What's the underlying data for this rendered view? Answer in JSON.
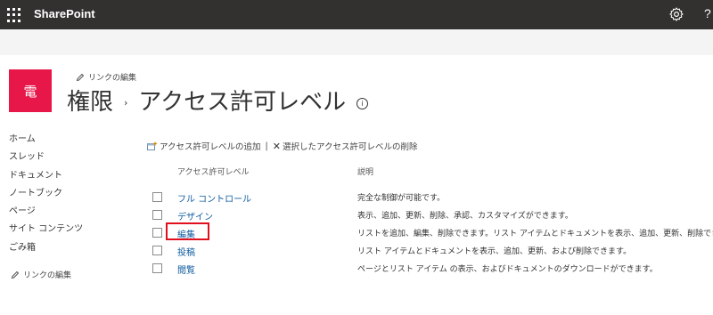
{
  "suite_bar": {
    "app_name": "SharePoint",
    "help_label": "?",
    "icons": [
      "waffle-icon",
      "gear-icon",
      "help-icon"
    ]
  },
  "site": {
    "logo_text": "電",
    "logo_color": "#e8174a",
    "edit_links_label": "リンクの編集"
  },
  "page": {
    "breadcrumb_parent": "権限",
    "breadcrumb_separator": "›",
    "title": "アクセス許可レベル",
    "info_icon": "i"
  },
  "quick_launch": {
    "items": [
      "ホーム",
      "スレッド",
      "ドキュメント",
      "ノートブック",
      "ページ",
      "サイト コンテンツ",
      "ごみ箱"
    ],
    "edit_links_label": "リンクの編集"
  },
  "toolbar": {
    "add_label": "アクセス許可レベルの追加",
    "separator": "|",
    "delete_label": "選択したアクセス許可レベルの削除"
  },
  "table": {
    "headers": {
      "name": "アクセス許可レベル",
      "description": "説明"
    },
    "rows": [
      {
        "name": "フル コントロール",
        "description": "完全な制御が可能です。"
      },
      {
        "name": "デザイン",
        "description": "表示、追加、更新、削除、承認、カスタマイズができます。"
      },
      {
        "name": "編集",
        "description": "リストを追加、編集、削除できます。リスト アイテムとドキュメントを表示、追加、更新、削除できます。"
      },
      {
        "name": "投稿",
        "description": "リスト アイテムとドキュメントを表示、追加、更新、および削除できます。"
      },
      {
        "name": "閲覧",
        "description": "ページとリスト アイテム の表示、およびドキュメントのダウンロードができます。"
      }
    ]
  },
  "colors": {
    "suite_bar": "#323130",
    "link": "#0f5b9f",
    "highlight_border": "#e0101e"
  }
}
